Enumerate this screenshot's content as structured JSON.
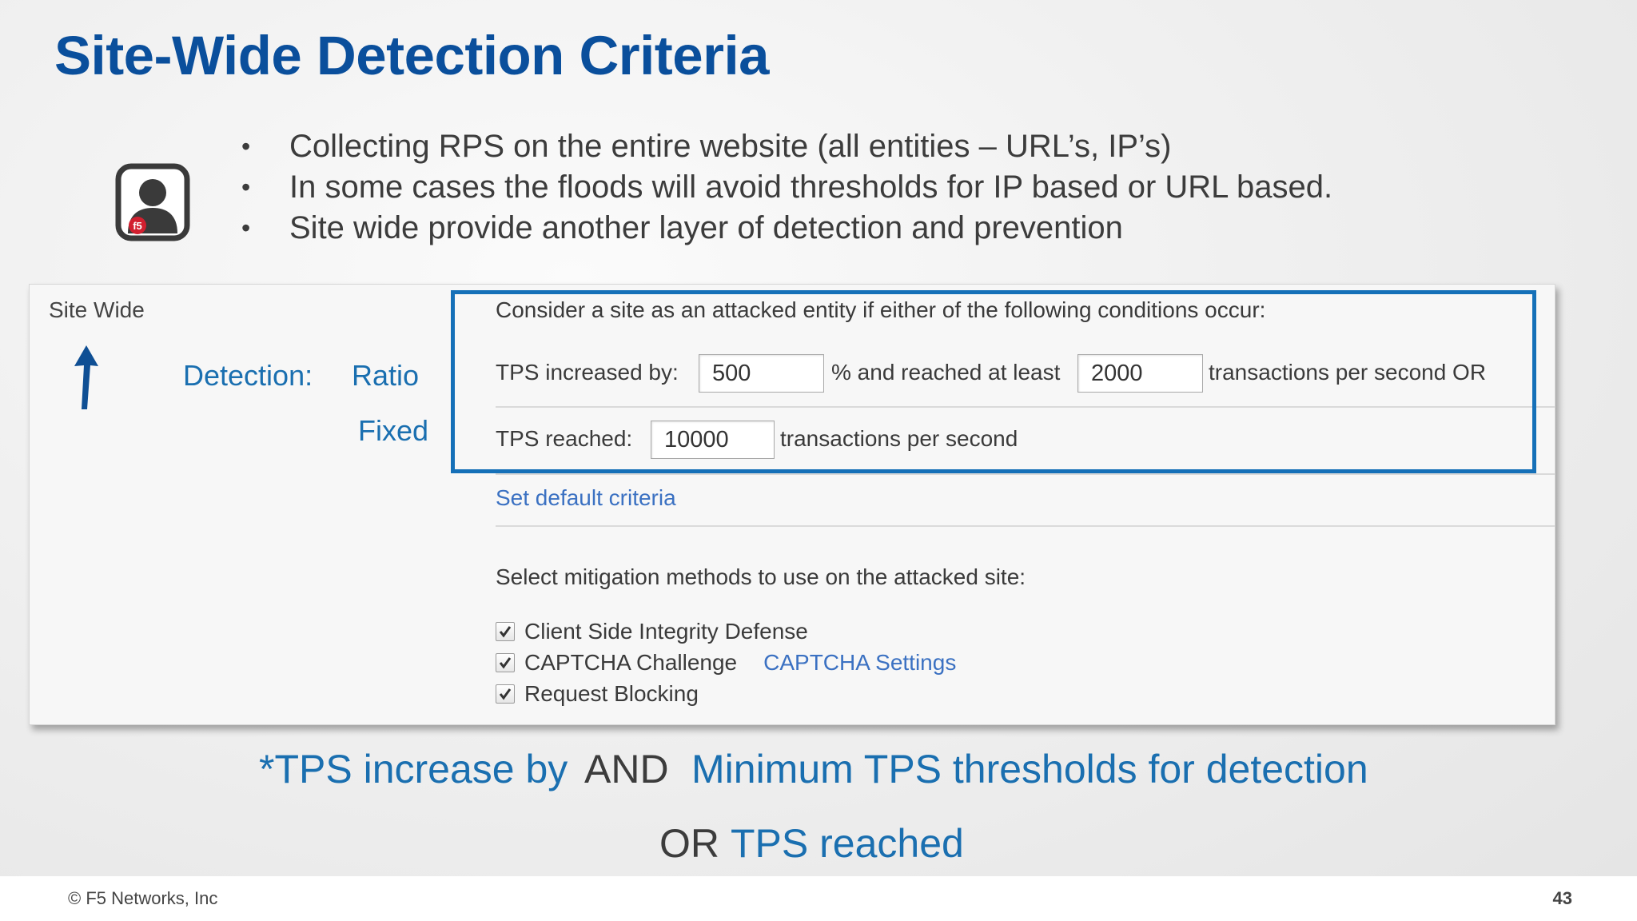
{
  "slide": {
    "title": "Site-Wide Detection Criteria",
    "bullets": [
      "Collecting RPS on the entire website (all entities – URL’s, IP’s)",
      "In some cases the floods will avoid thresholds for IP based or URL based.",
      "Site wide provide another layer of detection and prevention"
    ],
    "bullet_glyph": "•",
    "user_icon": "user-silhouette-icon",
    "user_icon_badge": "f5",
    "colors": {
      "title": "#0a4f9c",
      "accent": "#1a6fb0",
      "link": "#3b71c2",
      "highlight": "#1570b8"
    }
  },
  "panel": {
    "site_wide_label": "Site Wide",
    "arrow_icon": "up-arrow-icon",
    "detection_label": "Detection:",
    "ratio_label": "Ratio",
    "fixed_label": "Fixed",
    "conditions_heading": "Consider a site as an attacked entity if either of the following conditions occur:",
    "ratio_row": {
      "label": "TPS increased by:",
      "increase_value": "500",
      "pct_text": "% and reached at least",
      "min_value": "2000",
      "suffix": "transactions per second OR"
    },
    "fixed_row": {
      "label": "TPS reached:",
      "value": "10000",
      "suffix": "transactions per second"
    },
    "default_link": "Set default criteria",
    "mitigation_heading": "Select mitigation methods to use on the attacked site:",
    "mitigations": [
      {
        "label": "Client Side Integrity Defense",
        "checked": true
      },
      {
        "label": "CAPTCHA Challenge",
        "checked": true
      },
      {
        "label": "Request Blocking",
        "checked": true
      }
    ],
    "captcha_settings_link": "CAPTCHA Settings"
  },
  "notes": {
    "line1_part1": "*TPS increase by",
    "line1_and": "AND",
    "line1_part2": "Minimum TPS thresholds for detection",
    "line2_or": "OR",
    "line2_part": "TPS reached"
  },
  "footer": {
    "copyright": "© F5 Networks, Inc",
    "page_number": "43"
  }
}
